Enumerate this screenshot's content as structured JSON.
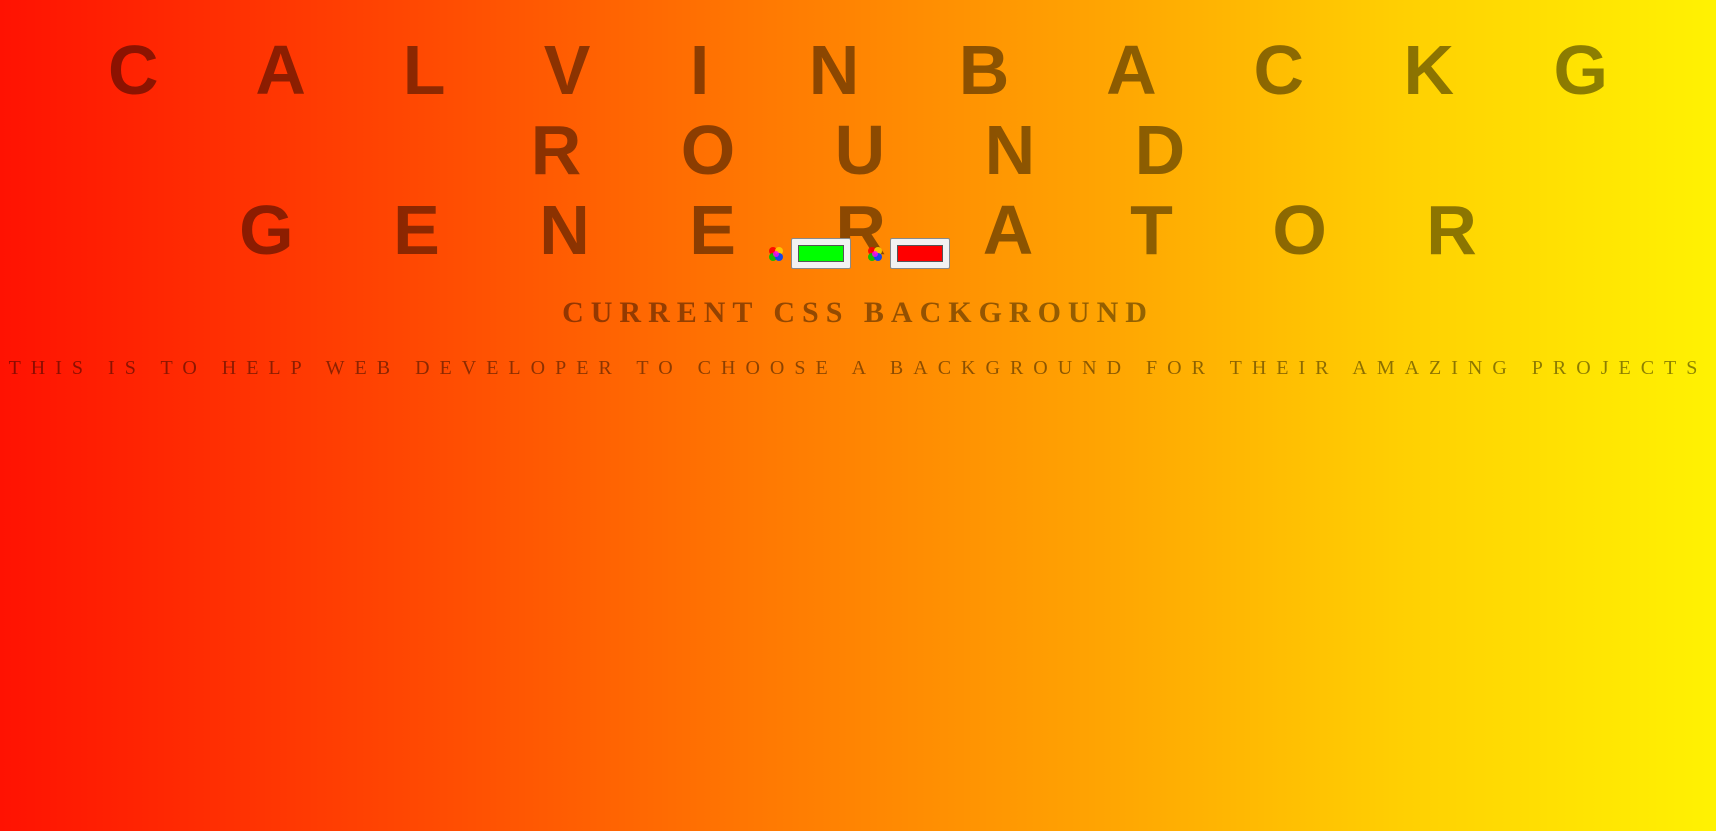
{
  "header": {
    "title_line1": "C A L V I N   B A C K G R O U N D",
    "title_line2": "G E N E R A T O R"
  },
  "pickers": {
    "color1": {
      "value": "#00ff00",
      "icon": "color-wheel-icon"
    },
    "color2": {
      "value": "#ff0000",
      "icon": "color-wheel-icon"
    }
  },
  "subtitle": "CURRENT CSS BACKGROUND",
  "tagline": "THIS IS TO HELP WEB DEVELOPER TO CHOOSE A BACKGROUND FOR THEIR AMAZING PROJECTS",
  "colors": {
    "gradient_start": "#ff1202",
    "gradient_end": "#fff202",
    "text": "rgba(0,0,0,0.45)"
  }
}
